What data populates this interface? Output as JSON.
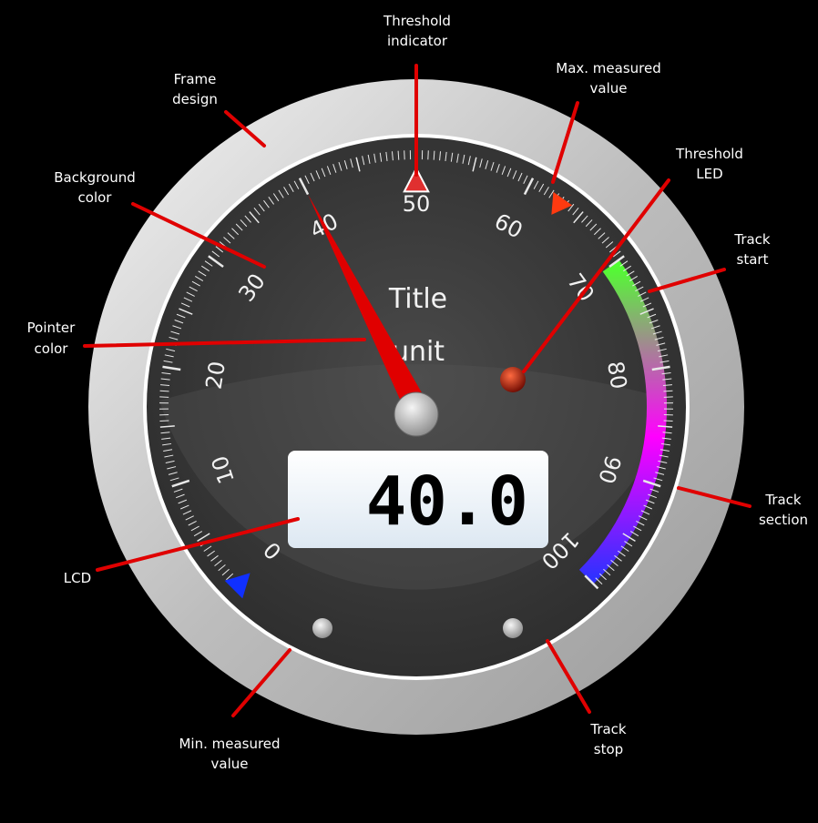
{
  "gauge": {
    "title": "Title",
    "unit": "unit",
    "lcd_value": "40.0",
    "value": 40.0,
    "min": 0,
    "max": 100,
    "tick_labels": [
      "0",
      "10",
      "20",
      "30",
      "40",
      "50",
      "60",
      "70",
      "80",
      "90",
      "100"
    ],
    "threshold": 50,
    "max_measured": 63,
    "min_measured": 0,
    "track_start": 70,
    "track_stop": 100,
    "colors": {
      "background": "#3a3a3a",
      "frame": "#c8c8c8",
      "pointer": "#e00000",
      "threshold_indicator": "#e03030",
      "max_indicator": "#ff3a10",
      "min_indicator": "#1030ff",
      "track_start": "#50ff30",
      "track_mid": "#ff00ff",
      "track_end": "#3030ff",
      "led": "#a01000",
      "callout_line": "#e00000",
      "lcd_bg": "#eef4fa"
    }
  },
  "callouts": {
    "threshold_indicator": [
      "Threshold",
      "indicator"
    ],
    "frame_design": [
      "Frame",
      "design"
    ],
    "max_measured_value": [
      "Max. measured",
      "value"
    ],
    "threshold_led": [
      "Threshold",
      "LED"
    ],
    "background_color": [
      "Background",
      "color"
    ],
    "track_start": [
      "Track",
      "start"
    ],
    "pointer_color": [
      "Pointer",
      "color"
    ],
    "track_section": [
      "Track",
      "section"
    ],
    "lcd": [
      "LCD"
    ],
    "min_measured_value": [
      "Min. measured",
      "value"
    ],
    "track_stop": [
      "Track",
      "stop"
    ]
  }
}
